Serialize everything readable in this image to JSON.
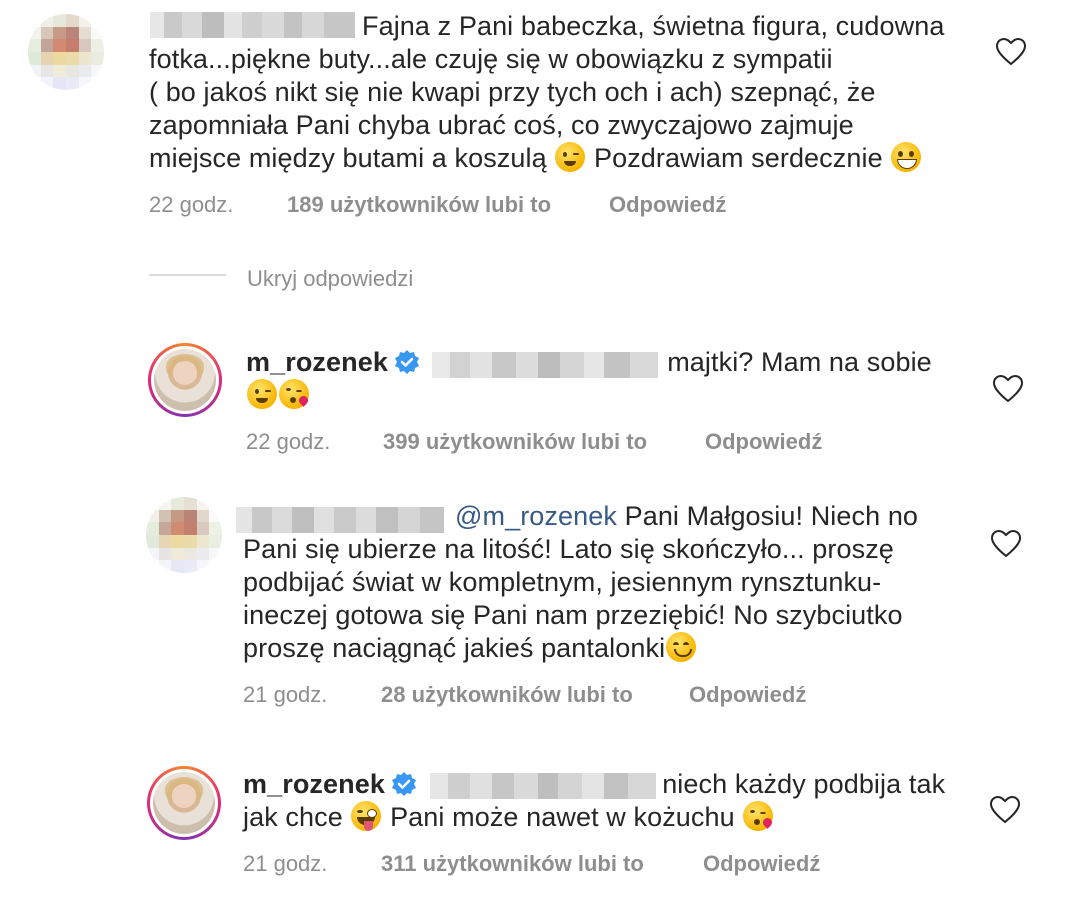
{
  "colors": {
    "text": "#262626",
    "meta": "#8e8e8e",
    "mention": "#385a87",
    "verified": "#3897f0",
    "divider": "#dbdbdb"
  },
  "comments": [
    {
      "line1": "Fajna z Pani babeczka, świetna figura, cudowna",
      "line2": "fotka...piękne buty...ale czuję się w obowiązku z sympatii",
      "line3": "( bo jakoś nikt się nie kwapi przy tych och i ach) szepnąć, że",
      "line4": "zapomniała Pani chyba ubrać coś, co zwyczajowo zajmuje",
      "line5a": "miejsce między butami a koszulą",
      "line5b": "Pozdrawiam serdecznie",
      "time": "22 godz.",
      "likes": "189 użytkowników lubi to",
      "reply": "Odpowiedź"
    },
    {
      "username": "m_rozenek",
      "line1": "majtki? Mam na sobie",
      "time": "22 godz.",
      "likes": "399 użytkowników lubi to",
      "reply": "Odpowiedź"
    },
    {
      "mention": "@m_rozenek",
      "line1": "Pani Małgosiu! Niech no",
      "line2": "Pani się ubierze na litość! Lato się skończyło... proszę",
      "line3": "podbijać świat w kompletnym, jesiennym rynsztunku-",
      "line4": "ineczej gotowa się Pani nam przeziębić! No szybciutko",
      "line5": "proszę naciągnąć jakieś pantalonki",
      "time": "21 godz.",
      "likes": "28 użytkowników lubi to",
      "reply": "Odpowiedź"
    },
    {
      "username": "m_rozenek",
      "line1": "niech każdy podbija tak",
      "line2a": "jak chce",
      "line2b": "Pani może nawet w kożuchu",
      "time": "21 godz.",
      "likes": "311 użytkowników lubi to",
      "reply": "Odpowiedź"
    }
  ],
  "hide_replies": "Ukryj odpowiedzi",
  "icons": [
    "heart-icon",
    "verified-badge-icon",
    "wink-emoji-icon",
    "grin-emoji-icon",
    "kiss-emoji-icon",
    "smile-emoji-icon",
    "tongue-emoji-icon"
  ]
}
